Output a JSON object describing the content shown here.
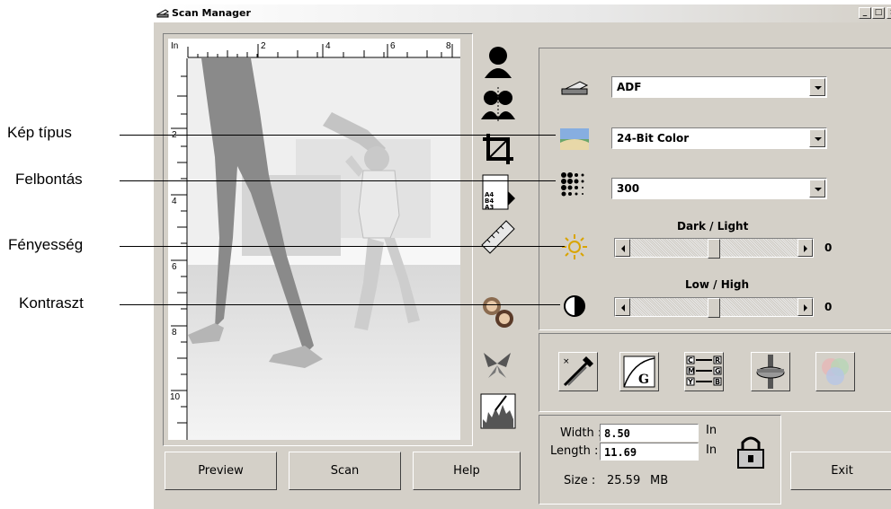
{
  "callouts": {
    "image_type": "Kép típus",
    "resolution": "Felbontás",
    "brightness": "Fényesség",
    "contrast": "Kontraszt"
  },
  "window": {
    "title": "Scan Manager",
    "minimize": "_",
    "maximize": "□",
    "close": "×"
  },
  "preview": {
    "ruler_unit": "In",
    "top_ticks": [
      "2",
      "4",
      "6",
      "8"
    ],
    "left_ticks": [
      "2",
      "4",
      "6",
      "8",
      "10"
    ]
  },
  "settings": {
    "source": "ADF",
    "image_type": "24-Bit Color",
    "resolution": "300",
    "brightness_label": "Dark / Light",
    "brightness_value": "0",
    "contrast_label": "Low / High",
    "contrast_value": "0"
  },
  "size": {
    "width_label": "Width :",
    "width_value": "8.50",
    "width_unit": "In",
    "length_label": "Length :",
    "length_value": "11.69",
    "length_unit": "In",
    "size_label": "Size :",
    "size_value": "25.59",
    "size_unit": "MB"
  },
  "buttons": {
    "preview": "Preview",
    "scan": "Scan",
    "help": "Help",
    "exit": "Exit"
  },
  "colors": {
    "window_bg": "#d4d0c8",
    "title_gradient_start": "#ffffff"
  }
}
